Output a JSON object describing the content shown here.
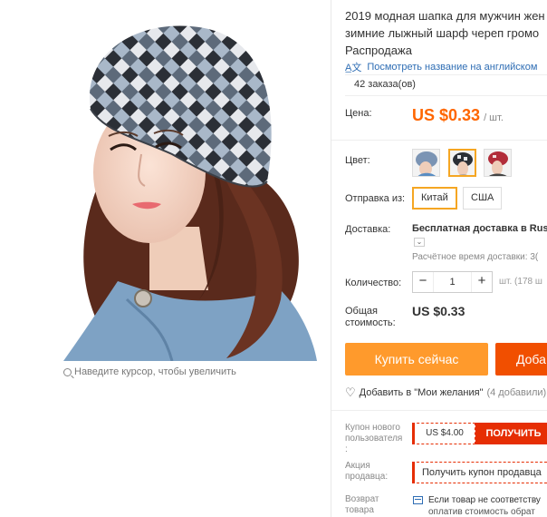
{
  "product": {
    "title_lines": [
      "2019 модная шапка для мужчин жен",
      "зимние лыжный шарф череп громо",
      "Распродажа"
    ],
    "translate_link": "Посмотреть название на английском",
    "orders": "42 заказа(ов)",
    "zoom_hint": "Наведите курсор, чтобы увеличить"
  },
  "price": {
    "label": "Цена:",
    "value": "US $0.33",
    "unit": "/ шт."
  },
  "color": {
    "label": "Цвет:",
    "swatches": [
      "blue-gray",
      "black-white-selected",
      "red"
    ]
  },
  "shipping_from": {
    "label": "Отправка из:",
    "options": [
      "Китай",
      "США"
    ],
    "selected": "Китай"
  },
  "delivery": {
    "label": "Доставка:",
    "main": "Бесплатная доставка в Russ",
    "time": "Расчётное время доставки: 3("
  },
  "quantity": {
    "label": "Количество:",
    "minus": "−",
    "value": "1",
    "plus": "+",
    "note": "шт. (178 ш"
  },
  "total": {
    "label_line1": "Общая",
    "label_line2": "стоимость:",
    "value": "US $0.33"
  },
  "actions": {
    "buy_now": "Купить сейчас",
    "add_to_cart": "Доба"
  },
  "wishlist": {
    "text": "Добавить в \"Мои желания\"",
    "count": "(4 добавили)"
  },
  "new_user_coupon": {
    "label_line1": "Купон нового",
    "label_line2": "пользователя",
    "label_line3": ":",
    "value": "US $4.00",
    "get": "ПОЛУЧИТЬ"
  },
  "seller_promo": {
    "label_line1": "Акция",
    "label_line2": "продавца:",
    "button": "Получить купон продавца"
  },
  "return": {
    "label_line1": "Возврат",
    "label_line2": "товара",
    "line1": "Если товар не соответству",
    "line2": "оплатив стоимость обрат"
  },
  "colors": {
    "price_orange": "#ff6600",
    "buy_orange": "#ff9a2c",
    "cart_red": "#f14f00",
    "coupon_red": "#e62e04",
    "link_blue": "#2e6db4",
    "selected_border": "#f5a623"
  }
}
